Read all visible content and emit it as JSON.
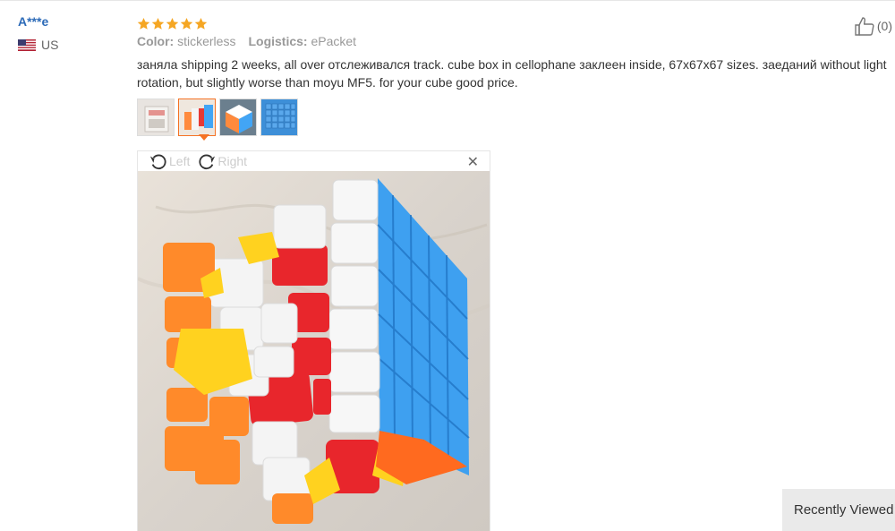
{
  "review": {
    "user_name": "A***e",
    "country": "US",
    "rating": 5,
    "color_label": "Color:",
    "color_value": "stickerless",
    "logistics_label": "Logistics:",
    "logistics_value": "ePacket",
    "text": "заняла shipping 2 weeks, all over отслеживался track. cube box in cellophane заклеен inside, 67x67x67 sizes. заеданий without light rotation, but slightly worse than moyu MF5. for your cube good price.",
    "like_count": "(0)"
  },
  "viewer": {
    "rotate_left_label": "Left",
    "rotate_right_label": "Right",
    "close_symbol": "✕"
  },
  "recently_viewed": "Recently Viewed",
  "colors": {
    "star": "#f5a623",
    "user_link": "#2d6bb8",
    "active_thumb": "#f57224"
  }
}
